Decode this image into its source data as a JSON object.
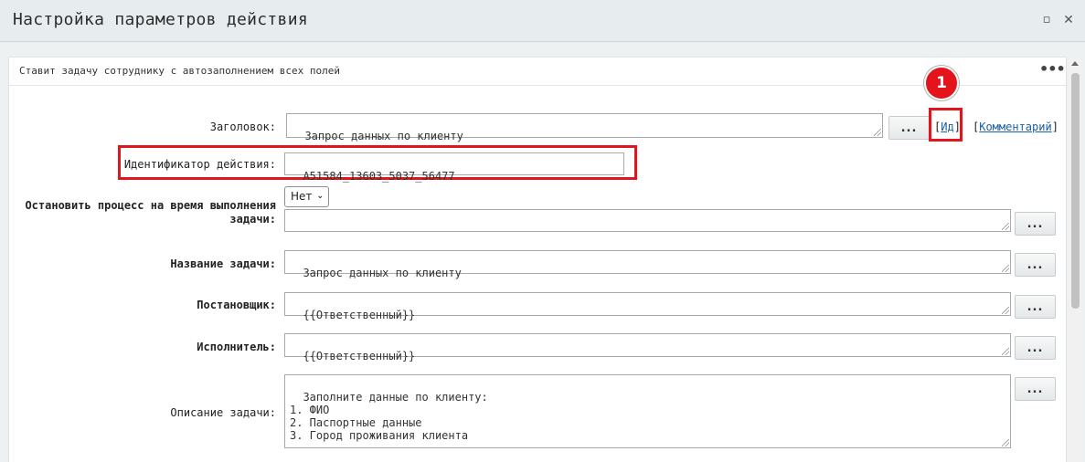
{
  "window": {
    "title": "Настройка параметров действия",
    "maximize_glyph": "▫",
    "close_glyph": "✕"
  },
  "panel": {
    "description": "Ставит задачу сотруднику с автозаполнением всех полей",
    "menu_glyph": "•••"
  },
  "callout": {
    "number": "1"
  },
  "fields": {
    "heading": {
      "label": "Заголовок:",
      "value": "Запрос данных по клиенту"
    },
    "action_id": {
      "label": "Идентификатор действия:",
      "value": "A51584_13603_5037_56477"
    },
    "stop_process": {
      "label": "Остановить процесс на время выполнения задачи:",
      "select_value": "Нет",
      "value": ""
    },
    "task_name": {
      "label": "Название задачи:",
      "value": "Запрос данных по клиенту"
    },
    "initiator": {
      "label": "Постановщик:",
      "value": "{{Ответственный}}"
    },
    "executor": {
      "label": "Исполнитель:",
      "value": "{{Ответственный}}"
    },
    "task_description": {
      "label": "Описание задачи:",
      "value": "Заполните данные по клиенту:\n1. ФИО\n2. Паспортные данные\n3. Город проживания клиента"
    }
  },
  "links": {
    "id_link": "Ид",
    "comment_link": "Комментарий",
    "bracket_open": "[",
    "bracket_close": "]"
  },
  "buttons": {
    "dots_label": "..."
  },
  "colors": {
    "highlight": "#e3141b",
    "link": "#1a5fa8",
    "titlebar": "#e7ecef"
  },
  "icons": [
    "maximize-icon",
    "close-icon",
    "more-icon",
    "resize-grip-icon",
    "chevron-down-icon"
  ]
}
